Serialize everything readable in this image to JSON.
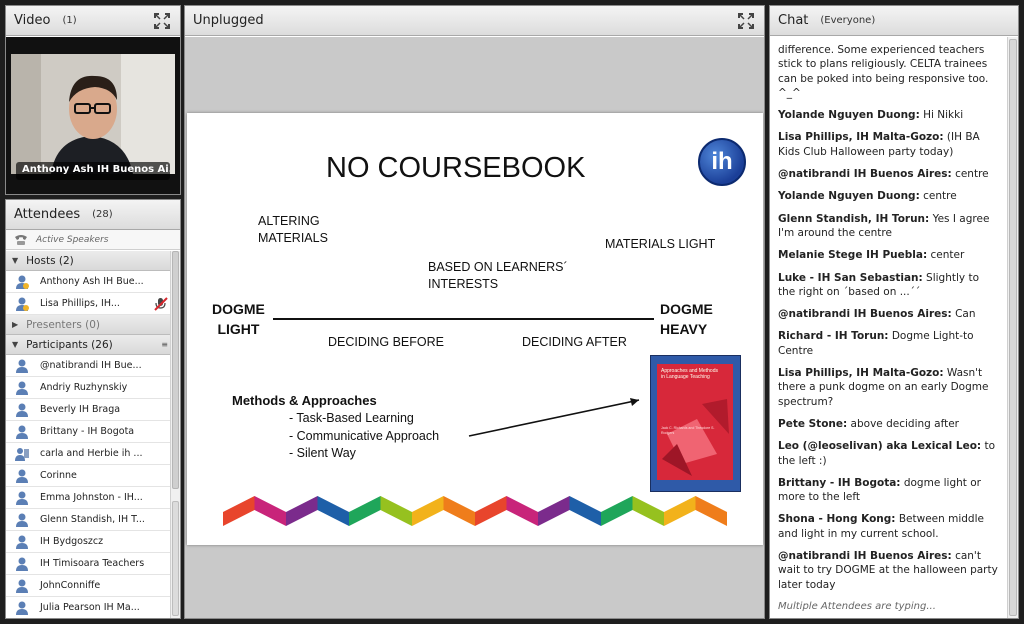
{
  "video": {
    "title": "Video",
    "count": "(1)",
    "caption": "Anthony Ash IH Buenos Ai..."
  },
  "share": {
    "title": "Unplugged",
    "slide": {
      "title": "NO COURSEBOOK",
      "logo": "ih",
      "altering1": "ALTERING",
      "altering2": "MATERIALS",
      "materials_light": "MATERIALS LIGHT",
      "based1": "BASED ON LEARNERS´",
      "based2": "INTERESTS",
      "dogme_left1": "DOGME",
      "dogme_left2": "LIGHT",
      "dogme_right1": "DOGME",
      "dogme_right2": "HEAVY",
      "deciding_before": "DECIDING BEFORE",
      "deciding_after": "DECIDING AFTER",
      "methods_heading": "Methods & Approaches",
      "methods": [
        "- Task-Based Learning",
        "- Communicative Approach",
        "- Silent Way"
      ],
      "book_title": "Approaches and Methods in Language Teaching",
      "book_authors": "Jack C. Richards and Theodore S. Rodgers"
    }
  },
  "attendees": {
    "title": "Attendees",
    "count": "(28)",
    "active_speakers": "Active Speakers",
    "hosts_label": "Hosts (2)",
    "hosts": [
      "Anthony Ash IH Bue...",
      "Lisa Phillips, IH..."
    ],
    "presenters_label": "Presenters (0)",
    "participants_label": "Participants (26)",
    "participants": [
      "@natibrandi IH Bue...",
      "Andriy Ruzhynskiy",
      "Beverly IH Braga",
      "Brittany - IH Bogota",
      "carla and Herbie ih ...",
      "Corinne",
      "Emma Johnston - IH...",
      "Glenn Standish, IH T...",
      "IH Bydgoszcz",
      "IH Timisoara Teachers",
      "JohnConniffe",
      "Julia Pearson IH Ma..."
    ]
  },
  "chat": {
    "title": "Chat",
    "scope": "(Everyone)",
    "messages": [
      {
        "name": "",
        "text": "difference. Some experienced teachers stick to plans religiously. CELTA trainees can be poked into being responsive too. ^_^"
      },
      {
        "name": "Yolande Nguyen Duong:",
        "text": " Hi Nikki"
      },
      {
        "name": "Lisa Phillips, IH Malta-Gozo:",
        "text": " (IH BA Kids Club Halloween party today)"
      },
      {
        "name": "@natibrandi IH Buenos Aires:",
        "text": " centre"
      },
      {
        "name": "Yolande Nguyen Duong:",
        "text": " centre"
      },
      {
        "name": "Glenn Standish, IH Torun:",
        "text": " Yes I agree I'm around the centre"
      },
      {
        "name": "Melanie Stege IH Puebla:",
        "text": " center"
      },
      {
        "name": "Luke - IH San Sebastian:",
        "text": " Slightly to the right on ´based on ...´´"
      },
      {
        "name": "@natibrandi IH Buenos Aires:",
        "text": " Can"
      },
      {
        "name": "Richard - IH Torun:",
        "text": " Dogme Light-to Centre"
      },
      {
        "name": "Lisa Phillips, IH Malta-Gozo:",
        "text": " Wasn't there a punk dogme on an early Dogme spectrum?"
      },
      {
        "name": "Pete Stone:",
        "text": " above deciding after"
      },
      {
        "name": "Leo (@leoselivan) aka Lexical Leo:",
        "text": " to the left :)"
      },
      {
        "name": "Brittany - IH Bogota:",
        "text": " dogme light or more to the left"
      },
      {
        "name": "Shona - Hong Kong:",
        "text": " Between middle and light in my current school."
      },
      {
        "name": "@natibrandi IH Buenos Aires:",
        "text": " can't wait to try DOGME at the halloween party later today"
      }
    ],
    "typing": "Multiple Attendees are typing..."
  },
  "colors": {
    "chevrons": [
      "#e8452c",
      "#c8247a",
      "#7b2b8c",
      "#1e5fa8",
      "#1fa65a",
      "#96c11f",
      "#f2b21b",
      "#ef7d1b"
    ]
  }
}
